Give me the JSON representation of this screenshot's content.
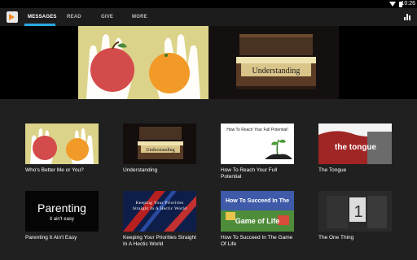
{
  "status": {
    "time": "10:26"
  },
  "tabs": [
    {
      "label": "MESSAGES",
      "active": true
    },
    {
      "label": "READ",
      "active": false
    },
    {
      "label": "GIVE",
      "active": false
    },
    {
      "label": "MORE",
      "active": false
    }
  ],
  "colors": {
    "accent": "#2aa7e0",
    "logo": "#f08a24",
    "background": "#202020"
  },
  "hero": {
    "right_text": "Understanding"
  },
  "messages": [
    {
      "title": "Who's Better Me or You?"
    },
    {
      "title": "Understanding",
      "thumb_text": "Understanding"
    },
    {
      "title": "How To Reach Your Full Potential",
      "thumb_text": "How To Reach Your Full Potential!"
    },
    {
      "title": "The Tongue",
      "thumb_text": "the tongue"
    },
    {
      "title": "Parenting It Ain't Easy",
      "thumb_text": "Parenting",
      "thumb_sub": "it ain't easy"
    },
    {
      "title": "Keeping Your Priorities Straight In A Hectic World",
      "thumb_text": "Keeping Your Priorities Straight In A Hectic World"
    },
    {
      "title": "How To Succeed In The Game Of Life",
      "thumb_text": "How To Succeed In The",
      "thumb_sub": "Game of Life"
    },
    {
      "title": "The One Thing",
      "thumb_text": "1"
    }
  ]
}
